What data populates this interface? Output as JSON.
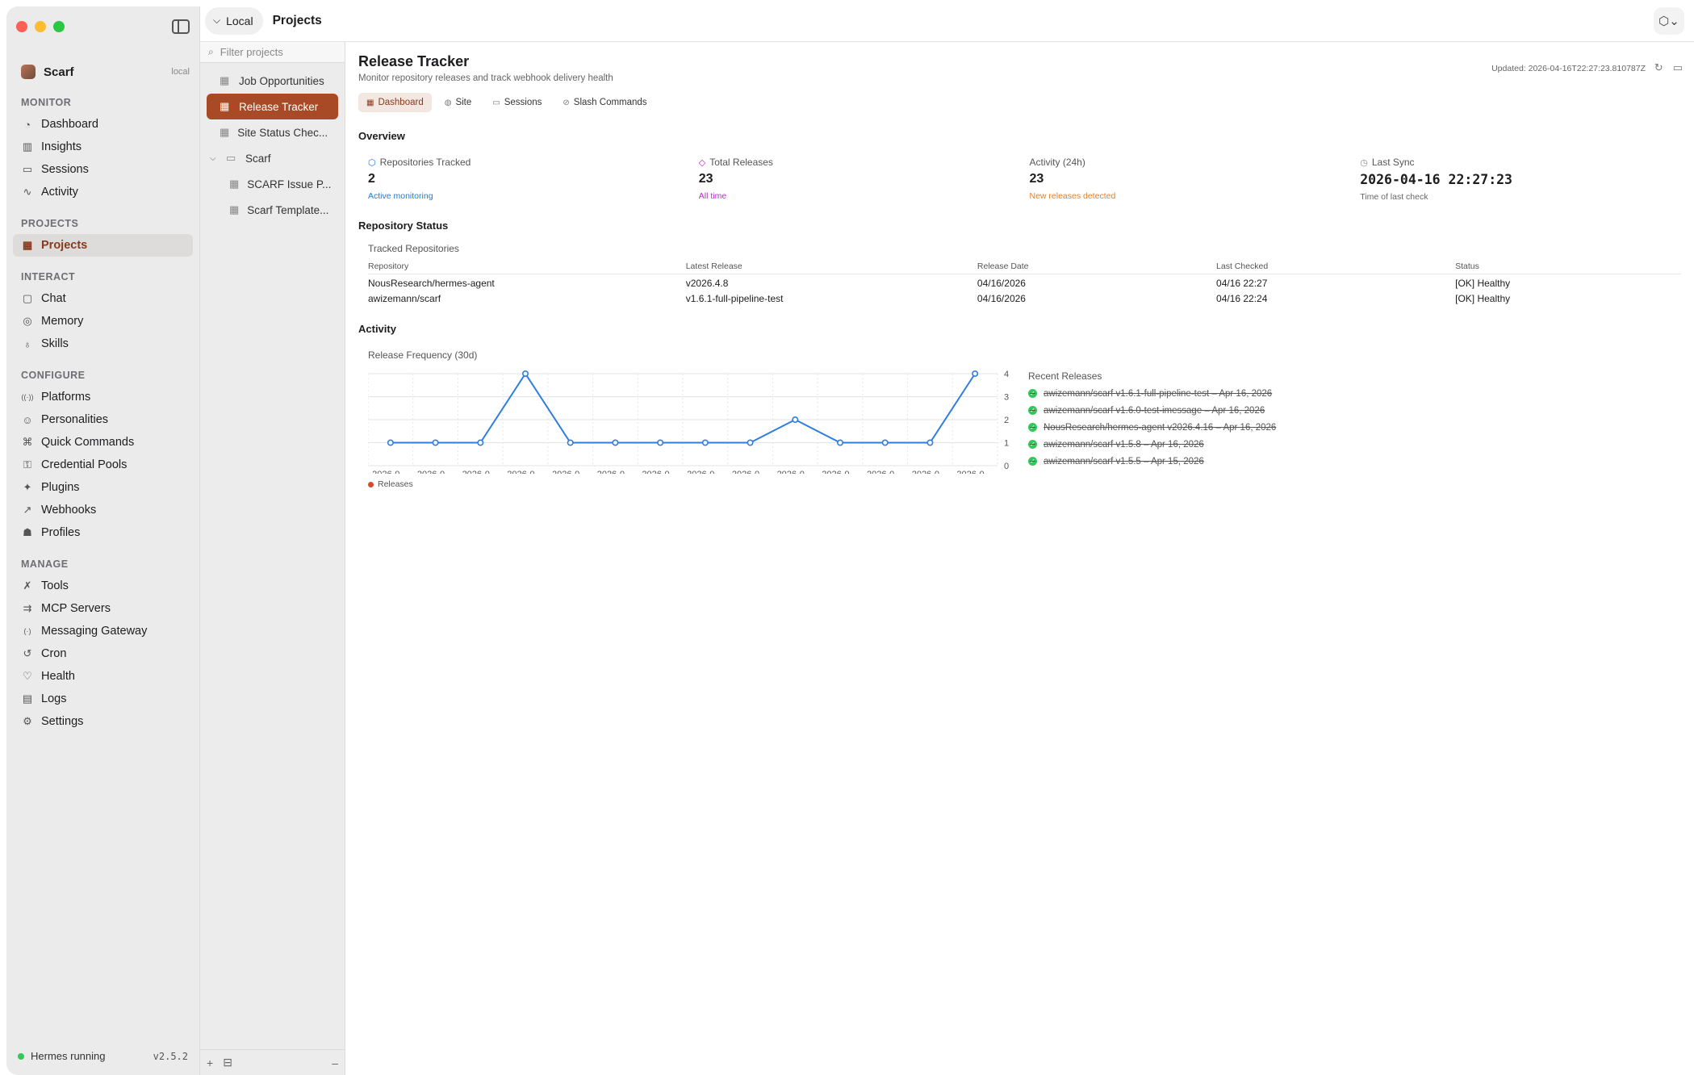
{
  "sidebar": {
    "profile": {
      "name": "Scarf",
      "tag": "local"
    },
    "sections": [
      {
        "title": "MONITOR",
        "items": [
          {
            "label": "Dashboard",
            "icon": "dashboard-icon",
            "glyph": "◔"
          },
          {
            "label": "Insights",
            "icon": "bar-chart-icon",
            "glyph": "▥"
          },
          {
            "label": "Sessions",
            "icon": "chat-bubbles-icon",
            "glyph": "▭"
          },
          {
            "label": "Activity",
            "icon": "activity-wave-icon",
            "glyph": "∿"
          }
        ]
      },
      {
        "title": "PROJECTS",
        "items": [
          {
            "label": "Projects",
            "icon": "grid-icon",
            "glyph": "▦",
            "active": true
          }
        ]
      },
      {
        "title": "INTERACT",
        "items": [
          {
            "label": "Chat",
            "icon": "chat-icon",
            "glyph": "▢"
          },
          {
            "label": "Memory",
            "icon": "brain-icon",
            "glyph": "◎"
          },
          {
            "label": "Skills",
            "icon": "lightbulb-icon",
            "glyph": "♁"
          }
        ]
      },
      {
        "title": "CONFIGURE",
        "items": [
          {
            "label": "Platforms",
            "icon": "broadcast-icon",
            "glyph": "((·))"
          },
          {
            "label": "Personalities",
            "icon": "masks-icon",
            "glyph": "☺"
          },
          {
            "label": "Quick Commands",
            "icon": "command-icon",
            "glyph": "⌘"
          },
          {
            "label": "Credential Pools",
            "icon": "key-icon",
            "glyph": "⚿"
          },
          {
            "label": "Plugins",
            "icon": "puzzle-icon",
            "glyph": "✦"
          },
          {
            "label": "Webhooks",
            "icon": "webhook-icon",
            "glyph": "↗"
          },
          {
            "label": "Profiles",
            "icon": "person-badge-icon",
            "glyph": "☗"
          }
        ]
      },
      {
        "title": "MANAGE",
        "items": [
          {
            "label": "Tools",
            "icon": "wrench-icon",
            "glyph": "✗"
          },
          {
            "label": "MCP Servers",
            "icon": "server-icon",
            "glyph": "⇉"
          },
          {
            "label": "Messaging Gateway",
            "icon": "antenna-icon",
            "glyph": "(·)"
          },
          {
            "label": "Cron",
            "icon": "clock-history-icon",
            "glyph": "↺"
          },
          {
            "label": "Health",
            "icon": "heart-icon",
            "glyph": "♡"
          },
          {
            "label": "Logs",
            "icon": "document-icon",
            "glyph": "▤"
          },
          {
            "label": "Settings",
            "icon": "gear-icon",
            "glyph": "⚙"
          }
        ]
      }
    ],
    "status": {
      "text": "Hermes running",
      "version": "v2.5.2"
    }
  },
  "topbar": {
    "location": "Local",
    "title": "Projects"
  },
  "projects": {
    "filter_placeholder": "Filter projects",
    "items": [
      {
        "label": "Job Opportunities",
        "kind": "item"
      },
      {
        "label": "Release Tracker",
        "kind": "item",
        "active": true
      },
      {
        "label": "Site Status Chec...",
        "kind": "item"
      },
      {
        "label": "Scarf",
        "kind": "folder"
      },
      {
        "label": "SCARF Issue P...",
        "kind": "child"
      },
      {
        "label": "Scarf Template...",
        "kind": "child"
      }
    ],
    "footer": {
      "add": "+",
      "archive": "⊟",
      "remove": "–"
    }
  },
  "main": {
    "title": "Release Tracker",
    "subtitle": "Monitor repository releases and track webhook delivery health",
    "updated": "Updated: 2026-04-16T22:27:23.810787Z",
    "tabs": [
      {
        "label": "Dashboard",
        "glyph": "▦",
        "active": true
      },
      {
        "label": "Site",
        "glyph": "◍"
      },
      {
        "label": "Sessions",
        "glyph": "▭"
      },
      {
        "label": "Slash Commands",
        "glyph": "⊘"
      }
    ],
    "overview_title": "Overview",
    "stats": [
      {
        "label": "Repositories Tracked",
        "value": "2",
        "note": "Active monitoring",
        "color": "#1f7ae0",
        "glyph": "⬡",
        "icon_color": "#1f7ae0"
      },
      {
        "label": "Total Releases",
        "value": "23",
        "note": "All time",
        "color": "#c026d3",
        "glyph": "◇",
        "icon_color": "#c026d3"
      },
      {
        "label": "Activity (24h)",
        "value": "23",
        "note": "New releases detected",
        "color": "#e67e22",
        "glyph": "",
        "icon_color": "#e67e22"
      },
      {
        "label": "Last Sync",
        "value": "2026-04-16 22:27:23",
        "note": "Time of last check",
        "color": "#666666",
        "glyph": "◷",
        "icon_color": "#888888",
        "mono": true
      }
    ],
    "repo_status_title": "Repository Status",
    "repo_table": {
      "caption": "Tracked Repositories",
      "headers": [
        "Repository",
        "Latest Release",
        "Release Date",
        "Last Checked",
        "Status"
      ],
      "rows": [
        [
          "NousResearch/hermes-agent",
          "v2026.4.8",
          "04/16/2026",
          "04/16 22:27",
          "[OK] Healthy"
        ],
        [
          "awizemann/scarf",
          "v1.6.1-full-pipeline-test",
          "04/16/2026",
          "04/16 22:24",
          "[OK] Healthy"
        ]
      ]
    },
    "activity_title": "Activity",
    "recent_title": "Recent Releases",
    "recent": [
      "awizemann/scarf v1.6.1-full-pipeline-test – Apr 16, 2026",
      "awizemann/scarf v1.6.0-test-imessage – Apr 16, 2026",
      "NousResearch/hermes-agent v2026.4.16 – Apr 16, 2026",
      "awizemann/scarf v1.5.8 – Apr 16, 2026",
      "awizemann/scarf v1.5.5 – Apr 15, 2026"
    ]
  },
  "chart_data": {
    "type": "line",
    "title": "Release Frequency (30d)",
    "categories": [
      "2026-0...",
      "2026-0...",
      "2026-0...",
      "2026-0...",
      "2026-0...",
      "2026-0...",
      "2026-0...",
      "2026-0...",
      "2026-0...",
      "2026-0...",
      "2026-0...",
      "2026-0...",
      "2026-0...",
      "2026-0..."
    ],
    "series": [
      {
        "name": "Releases",
        "values": [
          1,
          1,
          1,
          4,
          1,
          1,
          1,
          1,
          1,
          2,
          1,
          1,
          1,
          4
        ]
      }
    ],
    "ylim": [
      0,
      4
    ],
    "yticks": [
      0,
      1,
      2,
      3,
      4
    ],
    "grid": true,
    "legend": "bottom-left",
    "line_color": "#2f7de1",
    "legend_color": "#d44a2b"
  }
}
